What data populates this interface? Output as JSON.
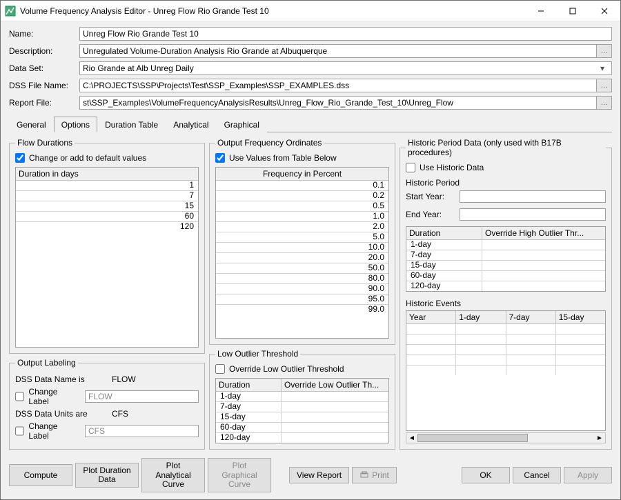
{
  "window": {
    "title": "Volume Frequency Analysis Editor - Unreg Flow Rio Grande Test 10"
  },
  "form": {
    "name_label": "Name:",
    "name_value": "Unreg Flow Rio Grande Test 10",
    "description_label": "Description:",
    "description_value": "Unregulated Volume-Duration Analysis Rio Grande at Albuquerque",
    "dataset_label": "Data Set:",
    "dataset_value": "Rio Grande at Alb Unreg Daily",
    "dssfile_label": "DSS File Name:",
    "dssfile_value": "C:\\PROJECTS\\SSP\\Projects\\Test\\SSP_Examples\\SSP_EXAMPLES.dss",
    "report_label": "Report File:",
    "report_value": "st\\SSP_Examples\\VolumeFrequencyAnalysisResults\\Unreg_Flow_Rio_Grande_Test_10\\Unreg_Flow"
  },
  "tabs": {
    "general": "General",
    "options": "Options",
    "duration_table": "Duration Table",
    "analytical": "Analytical",
    "graphical": "Graphical"
  },
  "flow_durations": {
    "legend": "Flow Durations",
    "checkbox_label": "Change or add to default values",
    "checkbox_checked": true,
    "header": "Duration in days",
    "values": [
      "1",
      "7",
      "15",
      "60",
      "120"
    ]
  },
  "output_labeling": {
    "legend": "Output Labeling",
    "name_label": "DSS Data Name is",
    "name_value": "FLOW",
    "units_label": "DSS Data Units are",
    "units_value": "CFS",
    "change_label_text": "Change Label",
    "name_input_value": "FLOW",
    "units_input_value": "CFS"
  },
  "output_freq": {
    "legend": "Output Frequency Ordinates",
    "checkbox_label": "Use Values from Table Below",
    "checkbox_checked": true,
    "header": "Frequency in Percent",
    "values": [
      "0.1",
      "0.2",
      "0.5",
      "1.0",
      "2.0",
      "5.0",
      "10.0",
      "20.0",
      "50.0",
      "80.0",
      "90.0",
      "95.0",
      "99.0"
    ]
  },
  "low_outlier": {
    "legend": "Low Outlier Threshold",
    "checkbox_label": "Override Low Outlier Threshold",
    "checkbox_checked": false,
    "col1": "Duration",
    "col2": "Override Low Outlier Th...",
    "durations": [
      "1-day",
      "7-day",
      "15-day",
      "60-day",
      "120-day"
    ]
  },
  "historic": {
    "legend": "Historic Period Data (only used with B17B procedures)",
    "use_label": "Use Historic Data",
    "use_checked": false,
    "period_label": "Historic Period",
    "start_label": "Start Year:",
    "end_label": "End Year:",
    "col1": "Duration",
    "col2": "Override High Outlier Thr...",
    "durations": [
      "1-day",
      "7-day",
      "15-day",
      "60-day",
      "120-day"
    ],
    "events_label": "Historic Events",
    "events_cols": [
      "Year",
      "1-day",
      "7-day",
      "15-day"
    ]
  },
  "buttons": {
    "compute": "Compute",
    "plot_duration": "Plot Duration\nData",
    "plot_analytical": "Plot Analytical\nCurve",
    "plot_graphical": "Plot Graphical\nCurve",
    "view_report": "View Report",
    "print": "Print",
    "ok": "OK",
    "cancel": "Cancel",
    "apply": "Apply"
  }
}
